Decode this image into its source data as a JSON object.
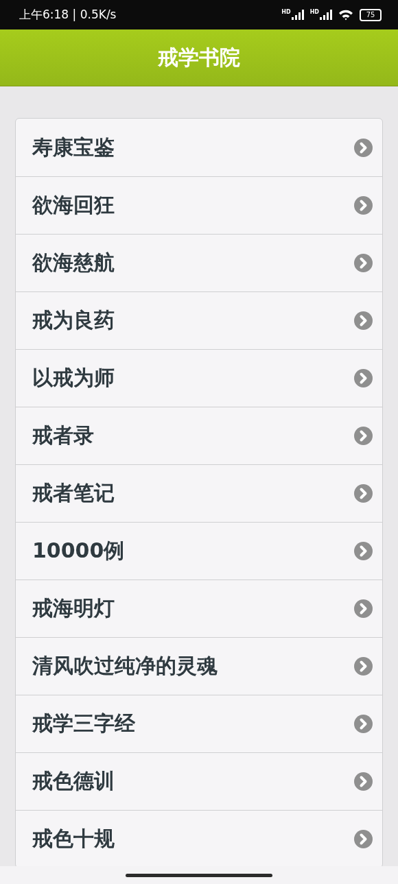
{
  "status_bar": {
    "time": "上午6:18 | 0.5K/s",
    "signal_labels": [
      "HD",
      "HD"
    ],
    "battery": "75"
  },
  "header": {
    "title": "戒学书院"
  },
  "items": [
    {
      "label": "寿康宝鉴"
    },
    {
      "label": "欲海回狂"
    },
    {
      "label": "欲海慈航"
    },
    {
      "label": "戒为良药"
    },
    {
      "label": "以戒为师"
    },
    {
      "label": "戒者录"
    },
    {
      "label": "戒者笔记"
    },
    {
      "label": "10000例"
    },
    {
      "label": "戒海明灯"
    },
    {
      "label": "清风吹过纯净的灵魂"
    },
    {
      "label": "戒学三字经"
    },
    {
      "label": "戒色德训"
    },
    {
      "label": "戒色十规"
    }
  ]
}
